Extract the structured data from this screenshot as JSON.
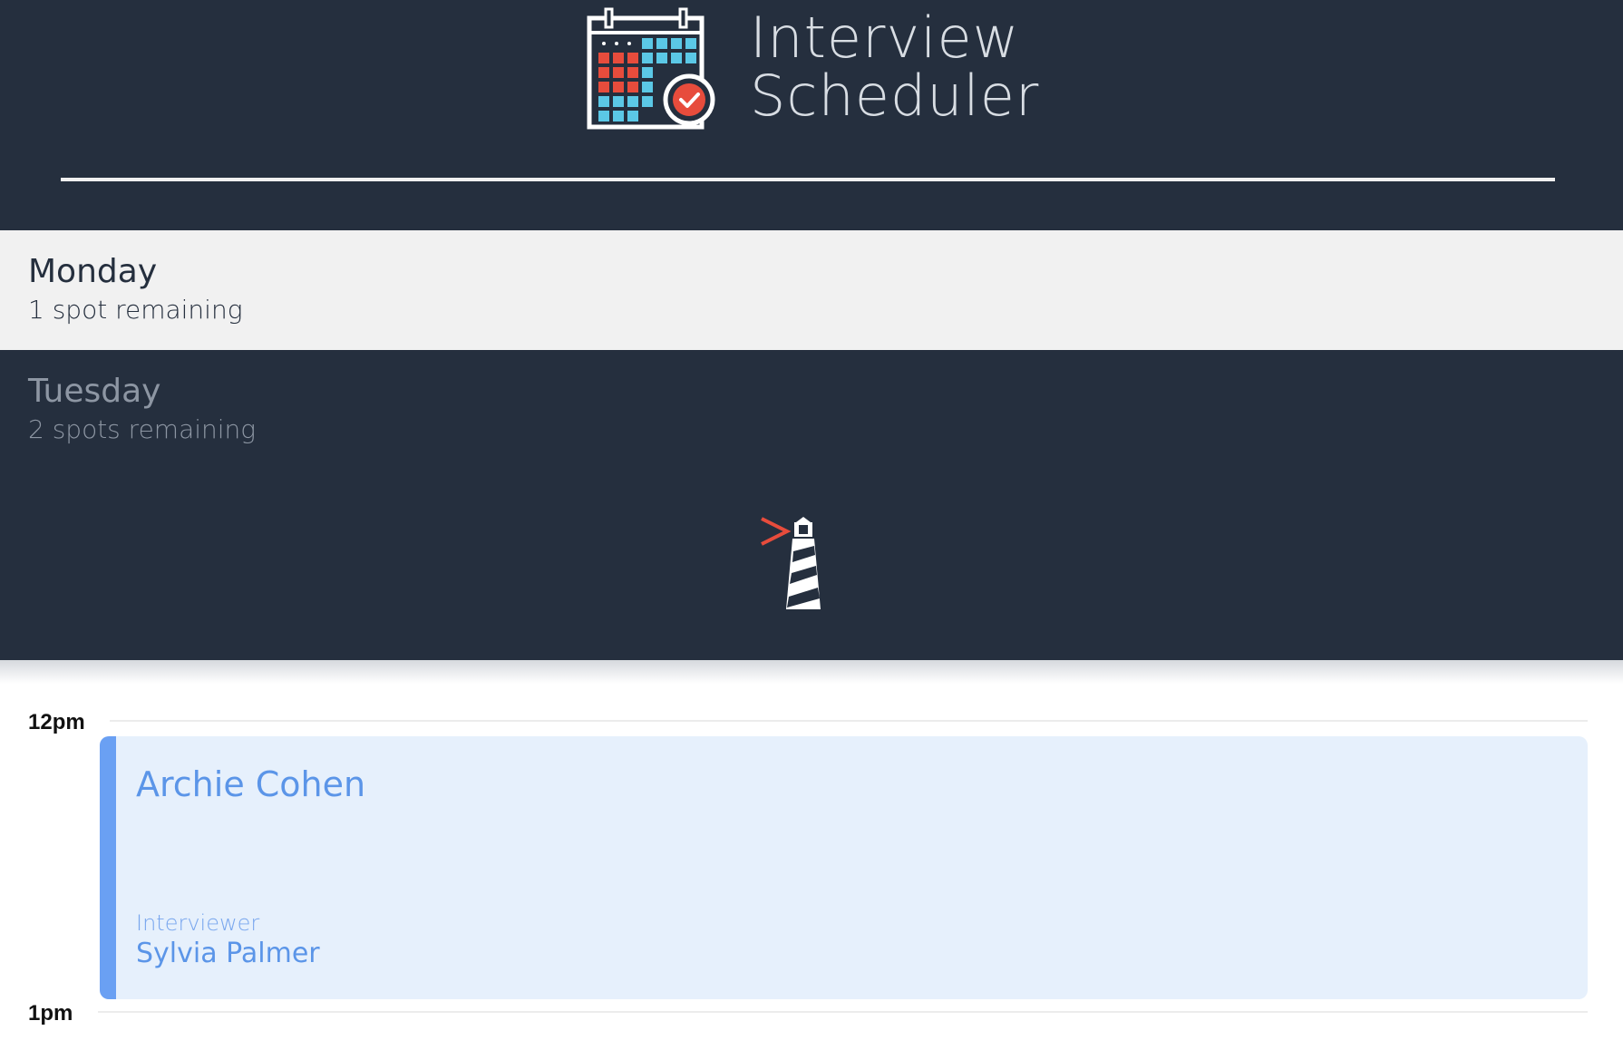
{
  "app": {
    "title_line1": "Interview",
    "title_line2": "Scheduler",
    "logo_icon": "calendar-check-icon"
  },
  "days": [
    {
      "name": "Monday",
      "spots": "1 spot remaining",
      "selected": false
    },
    {
      "name": "Tuesday",
      "spots": "2 spots remaining",
      "selected": true
    }
  ],
  "brand_icon": "lighthouse-icon",
  "schedule": {
    "times": [
      "12pm",
      "1pm"
    ],
    "appointment": {
      "student": "Archie Cohen",
      "interviewer_label": "Interviewer",
      "interviewer": "Sylvia Palmer"
    }
  },
  "colors": {
    "header_bg": "#252f3e",
    "selected_day_bg": "#252f3e",
    "day_bg": "#f1f1f1",
    "appointment_bg": "#e6f0fc",
    "appointment_accent": "#6aa0f3",
    "logo_red": "#e74c3c",
    "logo_cyan": "#5bc8e6"
  }
}
